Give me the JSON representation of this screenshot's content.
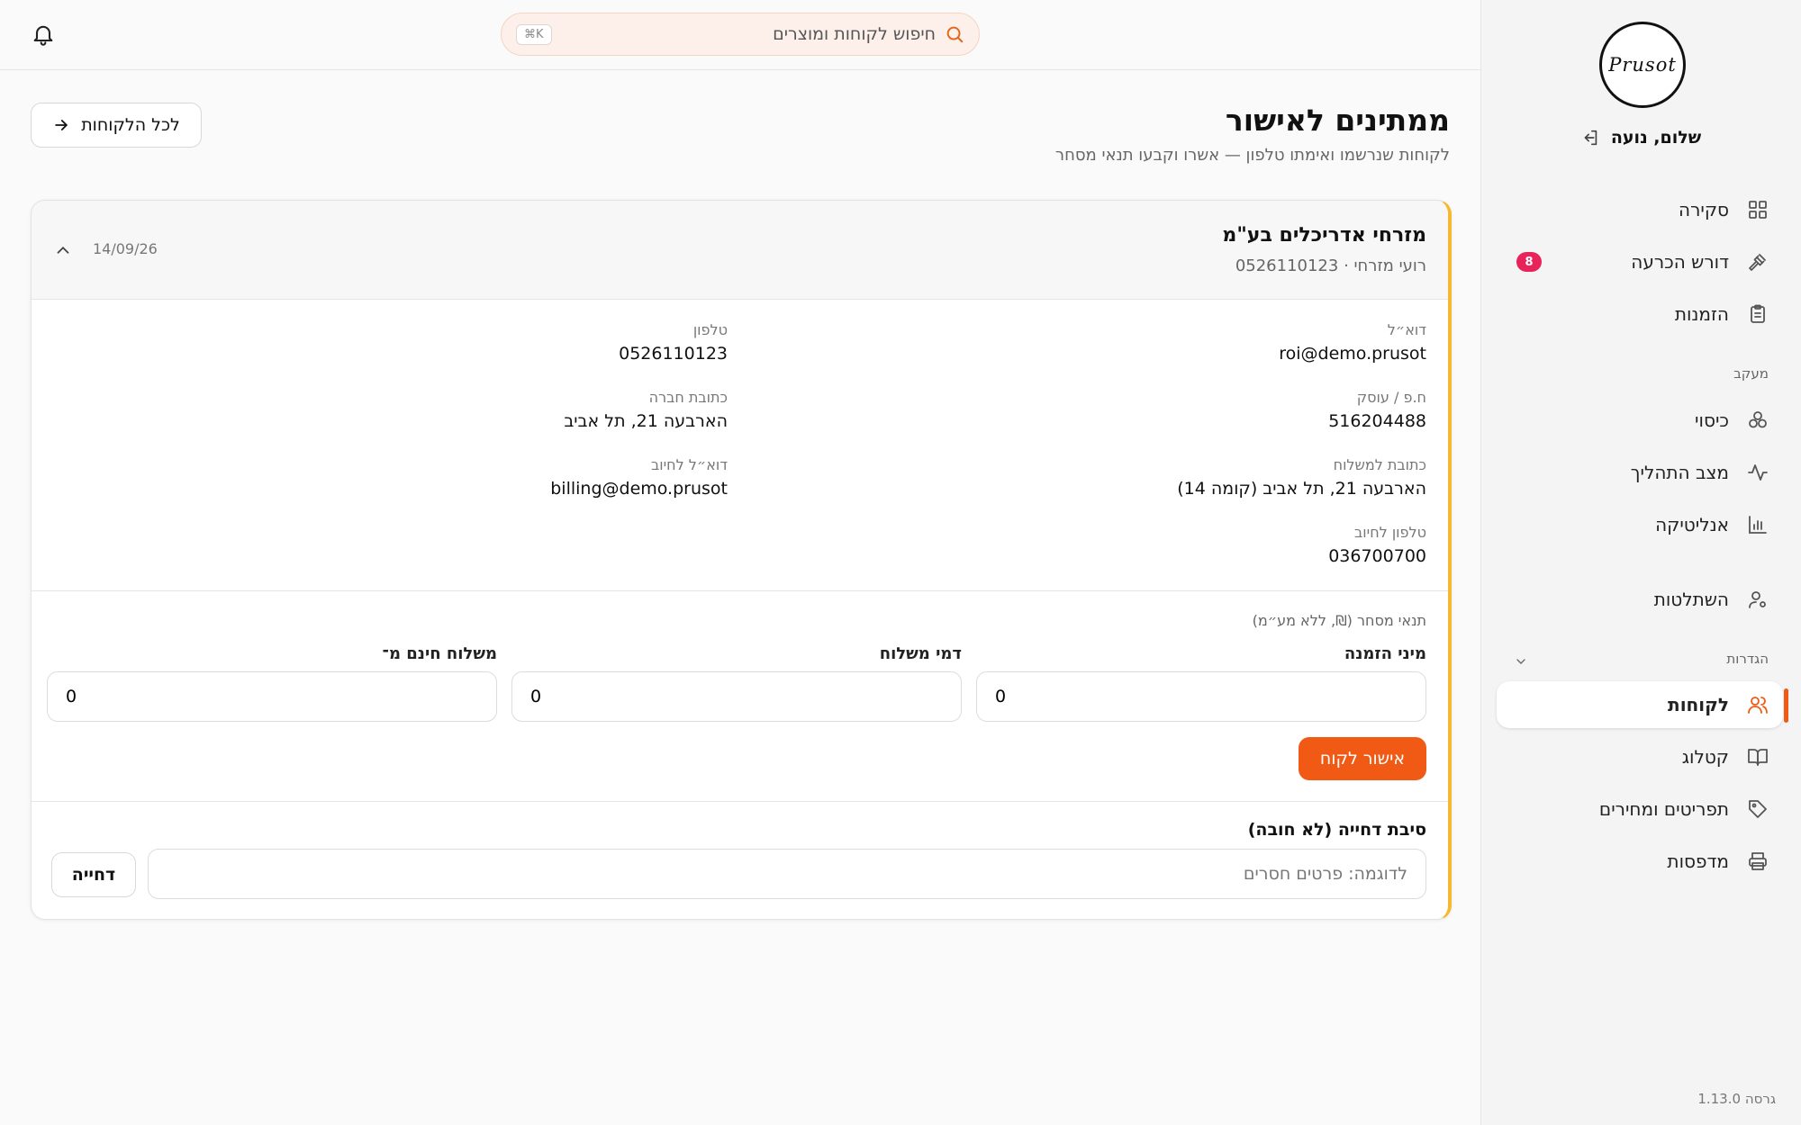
{
  "sidebar": {
    "logo_text": "Prusot",
    "greeting": "שלום, נועה",
    "nav": {
      "overview": "סקירה",
      "needs_decision": "דורש הכרעה",
      "needs_decision_badge": "8",
      "orders": "הזמנות",
      "section_tracking": "מעקב",
      "coverage": "כיסוי",
      "process_status": "מצב התהליך",
      "analytics": "אנליטיקה",
      "subscriptions": "השתלטות",
      "section_settings": "הגדרות",
      "customers": "לקוחות",
      "catalog": "קטלוג",
      "menus_prices": "תפריטים ומחירים",
      "printers": "מדפסות"
    },
    "version": "גרסה 1.13.0"
  },
  "topbar": {
    "search_placeholder": "חיפוש לקוחות ומוצרים",
    "shortcut": "⌘K"
  },
  "page": {
    "title": "ממתינים לאישור",
    "subtitle": "לקוחות שנרשמו ואימתו טלפון — אשרו וקבעו תנאי מסחר",
    "back_button": "לכל הלקוחות"
  },
  "card": {
    "company": "מזרחי אדריכלים בע\"מ",
    "subline": "רועי מזרחי · 0526110123",
    "date": "14/09/26",
    "fields": {
      "email_label": "דוא״ל",
      "email_value": "roi@demo.prusot",
      "phone_label": "טלפון",
      "phone_value": "0526110123",
      "company_id_label": "ח.פ / עוסק",
      "company_id_value": "516204488",
      "company_address_label": "כתובת חברה",
      "company_address_value": "הארבעה 21, תל אביב",
      "shipping_address_label": "כתובת למשלוח",
      "shipping_address_value": "הארבעה 21, תל אביב (קומה 14)",
      "billing_email_label": "דוא״ל לחיוב",
      "billing_email_value": "billing@demo.prusot",
      "billing_phone_label": "טלפון לחיוב",
      "billing_phone_value": "036700700"
    },
    "terms": {
      "title": "תנאי מסחר (₪, ללא מע״מ)",
      "min_order_label": "מיני הזמנה",
      "min_order_value": "0",
      "shipping_fee_label": "דמי משלוח",
      "shipping_fee_value": "0",
      "free_shipping_label": "משלוח חינם מ־",
      "free_shipping_value": "0"
    },
    "approve_button": "אישור לקוח",
    "reject": {
      "label": "סיבת דחייה (לא חובה)",
      "placeholder": "לדוגמה: פרטים חסרים",
      "button": "דחייה"
    }
  },
  "colors": {
    "accent": "#f05a14",
    "badge": "#e8235a",
    "card_border": "#f5b82e"
  }
}
